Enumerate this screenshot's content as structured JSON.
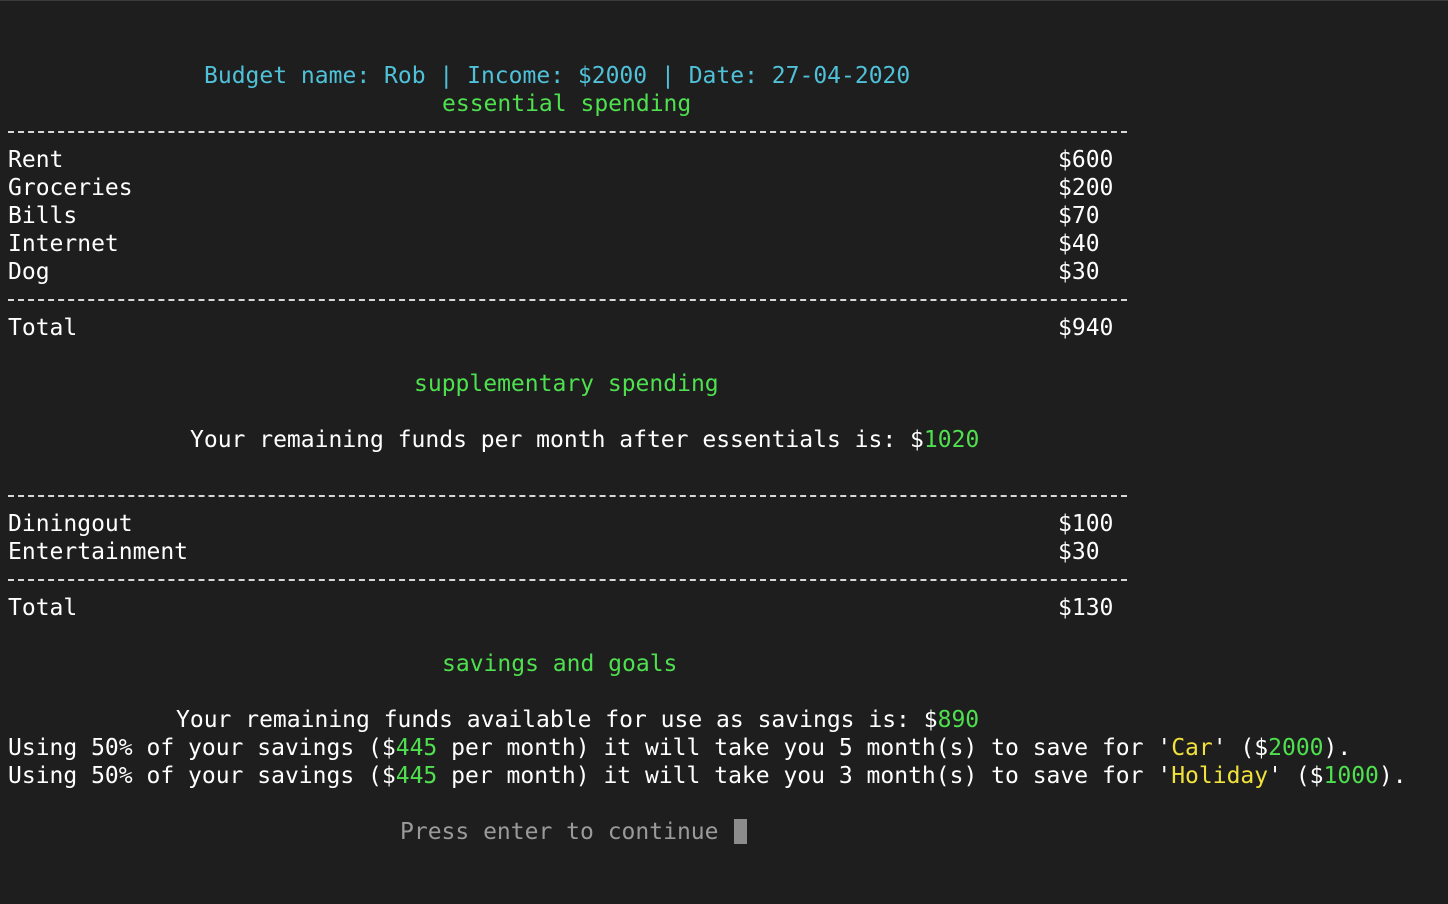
{
  "header": {
    "budget_label": "Budget name: ",
    "budget_name": "Rob",
    "sep1": " | ",
    "income_label": "Income: ",
    "income_value": "$2000",
    "sep2": " | ",
    "date_label": "Date: ",
    "date_value": "27-04-2020"
  },
  "essential": {
    "heading": "essential spending",
    "items": [
      {
        "label": "Rent",
        "amount": "$600"
      },
      {
        "label": "Groceries",
        "amount": "$200"
      },
      {
        "label": "Bills",
        "amount": "$70"
      },
      {
        "label": "Internet",
        "amount": "$40"
      },
      {
        "label": "Dog",
        "amount": "$30"
      }
    ],
    "total_label": "Total",
    "total_amount": "$940"
  },
  "supplementary": {
    "heading": "supplementary spending",
    "remaining_text": "Your remaining funds per month after essentials is: $",
    "remaining_value": "1020",
    "items": [
      {
        "label": "Diningout",
        "amount": "$100"
      },
      {
        "label": "Entertainment",
        "amount": "$30"
      }
    ],
    "total_label": "Total",
    "total_amount": "$130"
  },
  "savings": {
    "heading": "savings and goals",
    "remaining_text": "Your remaining funds available for use as savings is: $",
    "remaining_value": "890",
    "goals": [
      {
        "pre": "Using 50% of your savings ($",
        "monthly": "445",
        "mid": " per month) it will take you 5 month(s) to save for '",
        "name": "Car",
        "post": "' ($",
        "target": "2000",
        "end": ")."
      },
      {
        "pre": "Using 50% of your savings ($",
        "monthly": "445",
        "mid": " per month) it will take you 3 month(s) to save for '",
        "name": "Holiday",
        "post": "' ($",
        "target": "1000",
        "end": ")."
      }
    ]
  },
  "prompt": {
    "text": "Press enter to continue "
  },
  "colors": {
    "background": "#1e1e1e",
    "cyan": "#4fc1d8",
    "green": "#4ee04e",
    "yellow": "#f0e13c",
    "dim": "#9a9a9a"
  }
}
